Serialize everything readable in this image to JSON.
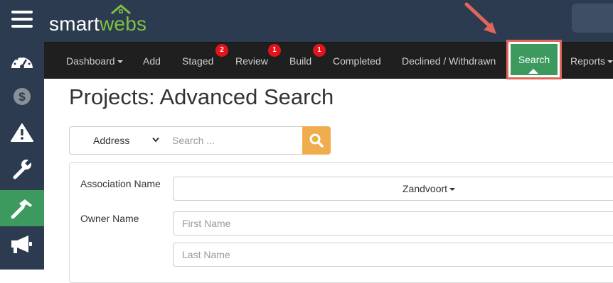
{
  "app": {
    "logo_part1": "smart",
    "logo_part2": "webs"
  },
  "sidebar": {
    "items": [
      {
        "icon": "menu-icon"
      },
      {
        "icon": "dashboard-gauge-icon"
      },
      {
        "icon": "dollar-icon"
      },
      {
        "icon": "warning-icon"
      },
      {
        "icon": "wrench-icon"
      },
      {
        "icon": "hammer-icon",
        "active": true
      },
      {
        "icon": "megaphone-icon"
      }
    ]
  },
  "nav": {
    "dashboard": "Dashboard",
    "add": "Add",
    "staged": "Staged",
    "staged_badge": "2",
    "review": "Review",
    "review_badge": "1",
    "build": "Build",
    "build_badge": "1",
    "completed": "Completed",
    "declined": "Declined / Withdrawn",
    "search": "Search",
    "reports": "Reports"
  },
  "page": {
    "title": "Projects: Advanced Search"
  },
  "search": {
    "type_selected": "Address",
    "placeholder": "Search ..."
  },
  "form": {
    "association_label": "Association Name",
    "association_value": "Zandvoort",
    "owner_label": "Owner Name",
    "first_name_placeholder": "First Name",
    "last_name_placeholder": "Last Name"
  },
  "colors": {
    "sidebar_bg": "#2c3b4f",
    "navbar_bg": "#1f1f1f",
    "active_green": "#3c9a5f",
    "badge_red": "#e3131b",
    "search_button": "#f0ad4e",
    "highlight_border": "#e0655a"
  }
}
